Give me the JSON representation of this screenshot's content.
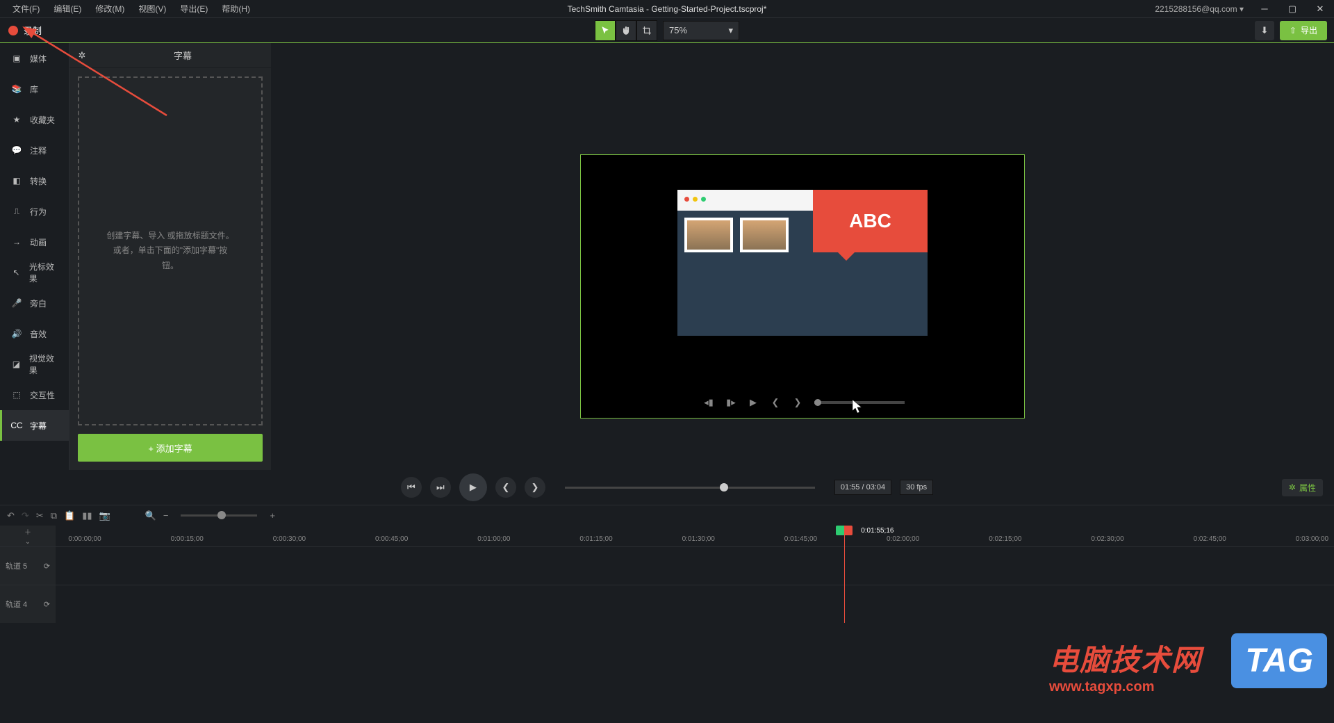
{
  "app_title": "TechSmith Camtasia - Getting-Started-Project.tscproj*",
  "account": "2215288156@qq.com ▾",
  "menu": {
    "file": "文件(F)",
    "edit": "编辑(E)",
    "modify": "修改(M)",
    "view": "视图(V)",
    "export": "导出(E)",
    "help": "帮助(H)"
  },
  "toolbar": {
    "record": "录制",
    "zoom": "75%",
    "export": "导出"
  },
  "rail": {
    "media": "媒体",
    "library": "库",
    "favorites": "收藏夹",
    "annotations": "注释",
    "transitions": "转换",
    "behaviors": "行为",
    "animations": "动画",
    "cursor": "光标效果",
    "narration": "旁白",
    "audio": "音效",
    "visual": "视觉效果",
    "interactivity": "交互性",
    "captions": "字幕"
  },
  "panel": {
    "title": "字幕",
    "dropzone": "创建字幕、导入 或拖放标题文件。\n或者，单击下面的\"添加字幕\"按\n钮。",
    "add_btn": "+  添加字幕"
  },
  "canvas": {
    "bubble_text": "ABC"
  },
  "playback": {
    "time": "01:55 / 03:04",
    "fps": "30 fps",
    "properties": "属性"
  },
  "timeline": {
    "playhead": "0:01:55;16",
    "ticks": [
      "0:00:00;00",
      "0:00:15;00",
      "0:00:30;00",
      "0:00:45;00",
      "0:01:00;00",
      "0:01:15;00",
      "0:01:30;00",
      "0:01:45;00",
      "0:02:00;00",
      "0:02:15;00",
      "0:02:30;00",
      "0:02:45;00",
      "0:03:00;00"
    ],
    "track5": "轨道 5",
    "track4": "轨道 4"
  },
  "watermark": {
    "cn": "电脑技术网",
    "url": "www.tagxp.com",
    "tag": "TAG"
  }
}
